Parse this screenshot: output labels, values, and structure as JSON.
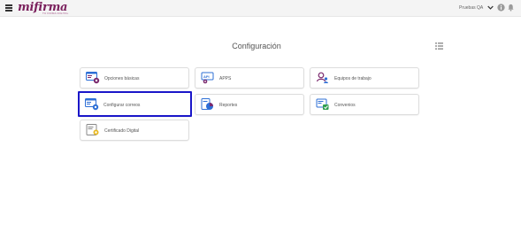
{
  "header": {
    "menu_icon": "hamburger-icon",
    "logo_text": "mifirma",
    "logo_subtext": "TU FIRMA DIGITAL",
    "user_name": "Pruebas QA",
    "icons": [
      "chevron-down-icon",
      "info-icon",
      "bell-icon"
    ]
  },
  "page": {
    "title": "Configuración",
    "view_icon": "list-view-icon"
  },
  "cards": [
    {
      "label": "Opciones básicas",
      "icon": "settings-icon"
    },
    {
      "label": "APPS",
      "icon": "api-icon"
    },
    {
      "label": "Equipos de trabajo",
      "icon": "team-icon"
    },
    {
      "label": "Configurar correos",
      "icon": "email-config-icon",
      "selected": true
    },
    {
      "label": "Reportes",
      "icon": "report-icon"
    },
    {
      "label": "Convenios",
      "icon": "agreement-icon"
    },
    {
      "label": "Certificado Digital",
      "icon": "certificate-icon"
    }
  ],
  "colors": {
    "selected_border": "#1a16c9",
    "logo": "#7a1f5c",
    "icon_blue": "#2d6fd6",
    "icon_purple": "#7b2a6e",
    "icon_green": "#2e9e4f",
    "icon_yellow": "#e8b923"
  }
}
